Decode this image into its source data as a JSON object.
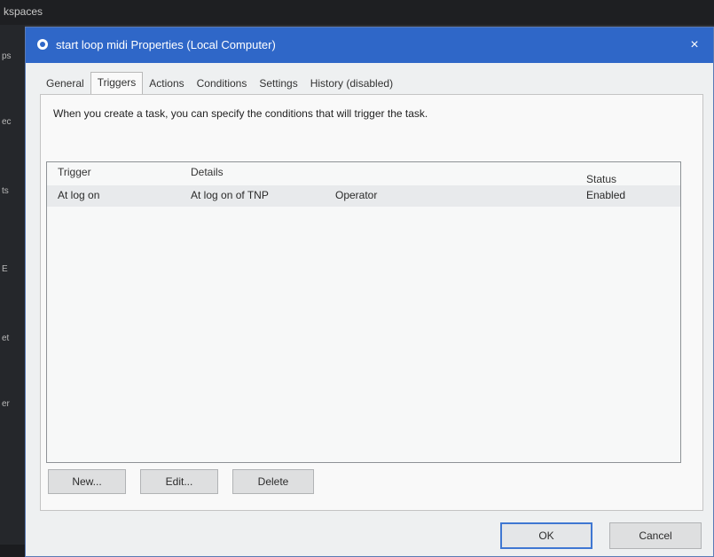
{
  "background": {
    "taskbar_label": "kspaces",
    "side_fragments": [
      "ps",
      "ec",
      "ts",
      "E",
      "et",
      "er"
    ]
  },
  "window": {
    "title": "start loop midi Properties (Local Computer)",
    "close_glyph": "×"
  },
  "tabs": [
    {
      "label": "General"
    },
    {
      "label": "Triggers"
    },
    {
      "label": "Actions"
    },
    {
      "label": "Conditions"
    },
    {
      "label": "Settings"
    },
    {
      "label": "History (disabled)"
    }
  ],
  "active_tab": "Triggers",
  "triggers_panel": {
    "description": "When you create a task, you can specify the conditions that will trigger the task.",
    "columns": {
      "trigger": "Trigger",
      "details": "Details",
      "status": "Status"
    },
    "rows": [
      {
        "trigger": "At log on",
        "details": "At log on of TNP",
        "details_user": "Operator",
        "status": "Enabled"
      }
    ],
    "buttons": {
      "new": "New...",
      "edit": "Edit...",
      "delete": "Delete"
    }
  },
  "footer": {
    "ok": "OK",
    "cancel": "Cancel"
  },
  "colors": {
    "titlebar": "#2f67c8",
    "dialog_bg": "#eef0f1",
    "ok_border": "#3f77d2"
  }
}
